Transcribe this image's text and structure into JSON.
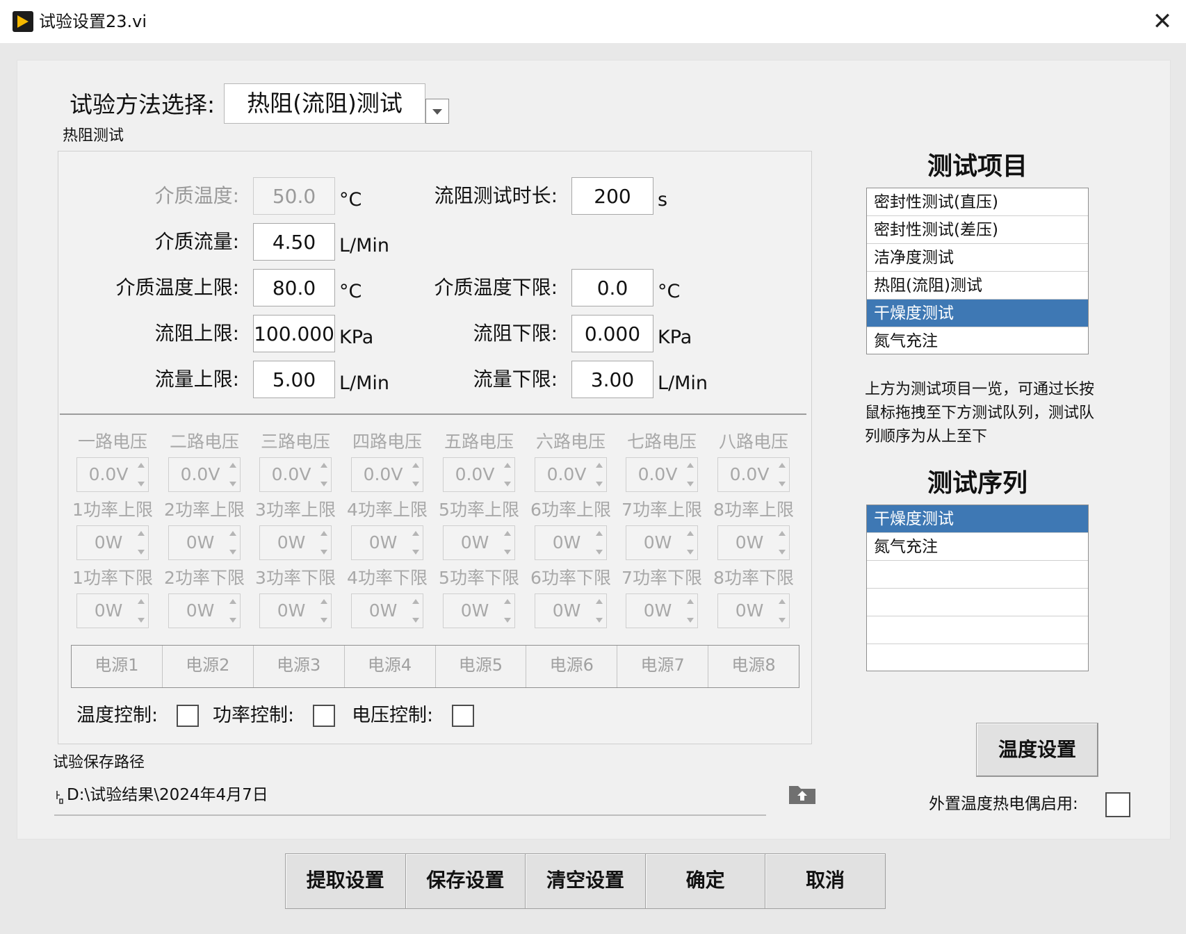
{
  "window": {
    "title": "试验设置23.vi",
    "close_label": "✕"
  },
  "method": {
    "label": "试验方法选择:",
    "selected": "热阻(流阻)测试"
  },
  "group": {
    "title": "热阻测试",
    "fields": {
      "medium_temp": {
        "label": "介质温度:",
        "value": "50.0",
        "unit": "°C"
      },
      "flow_time": {
        "label": "流阻测试时长:",
        "value": "200",
        "unit": "s"
      },
      "medium_flow": {
        "label": "介质流量:",
        "value": "4.50",
        "unit": "L/Min"
      },
      "temp_upper": {
        "label": "介质温度上限:",
        "value": "80.0",
        "unit": "°C"
      },
      "temp_lower": {
        "label": "介质温度下限:",
        "value": "0.0",
        "unit": "°C"
      },
      "resist_upper": {
        "label": "流阻上限:",
        "value": "100.000",
        "unit": "KPa"
      },
      "resist_lower": {
        "label": "流阻下限:",
        "value": "0.000",
        "unit": "KPa"
      },
      "flow_upper": {
        "label": "流量上限:",
        "value": "5.00",
        "unit": "L/Min"
      },
      "flow_lower": {
        "label": "流量下限:",
        "value": "3.00",
        "unit": "L/Min"
      }
    },
    "channels": [
      {
        "voltage_label": "一路电压",
        "voltage": "0.0V",
        "pmax_label": "1功率上限",
        "pmax": "0W",
        "pmin_label": "1功率下限",
        "pmin": "0W"
      },
      {
        "voltage_label": "二路电压",
        "voltage": "0.0V",
        "pmax_label": "2功率上限",
        "pmax": "0W",
        "pmin_label": "2功率下限",
        "pmin": "0W"
      },
      {
        "voltage_label": "三路电压",
        "voltage": "0.0V",
        "pmax_label": "3功率上限",
        "pmax": "0W",
        "pmin_label": "3功率下限",
        "pmin": "0W"
      },
      {
        "voltage_label": "四路电压",
        "voltage": "0.0V",
        "pmax_label": "4功率上限",
        "pmax": "0W",
        "pmin_label": "4功率下限",
        "pmin": "0W"
      },
      {
        "voltage_label": "五路电压",
        "voltage": "0.0V",
        "pmax_label": "5功率上限",
        "pmax": "0W",
        "pmin_label": "5功率下限",
        "pmin": "0W"
      },
      {
        "voltage_label": "六路电压",
        "voltage": "0.0V",
        "pmax_label": "6功率上限",
        "pmax": "0W",
        "pmin_label": "6功率下限",
        "pmin": "0W"
      },
      {
        "voltage_label": "七路电压",
        "voltage": "0.0V",
        "pmax_label": "7功率上限",
        "pmax": "0W",
        "pmin_label": "7功率下限",
        "pmin": "0W"
      },
      {
        "voltage_label": "八路电压",
        "voltage": "0.0V",
        "pmax_label": "8功率上限",
        "pmax": "0W",
        "pmin_label": "8功率下限",
        "pmin": "0W"
      }
    ],
    "power_sources": [
      "电源1",
      "电源2",
      "电源3",
      "电源4",
      "电源5",
      "电源6",
      "电源7",
      "电源8"
    ],
    "controls": {
      "temp_label": "温度控制:",
      "power_label": "功率控制:",
      "voltage_label": "电压控制:"
    }
  },
  "save_path": {
    "title": "试验保存路径",
    "value": "D:\\试验结果\\2024年4月7日"
  },
  "test_items": {
    "title": "测试项目",
    "items": [
      "密封性测试(直压)",
      "密封性测试(差压)",
      "洁净度测试",
      "热阻(流阻)测试",
      "干燥度测试",
      "氮气充注"
    ],
    "selected_index": 4
  },
  "hint": "上方为测试项目一览，可通过长按鼠标拖拽至下方测试队列，测试队列顺序为从上至下",
  "test_sequence": {
    "title": "测试序列",
    "items": [
      "干燥度测试",
      "氮气充注",
      "",
      "",
      "",
      ""
    ],
    "selected_index": 0
  },
  "temp_settings_label": "温度设置",
  "external_thermocouple_label": "外置温度热电偶启用:",
  "buttons": {
    "load": "提取设置",
    "save": "保存设置",
    "clear": "清空设置",
    "ok": "确定",
    "cancel": "取消"
  },
  "colors": {
    "selection": "#3e78b4",
    "accent": "#f5b800"
  }
}
